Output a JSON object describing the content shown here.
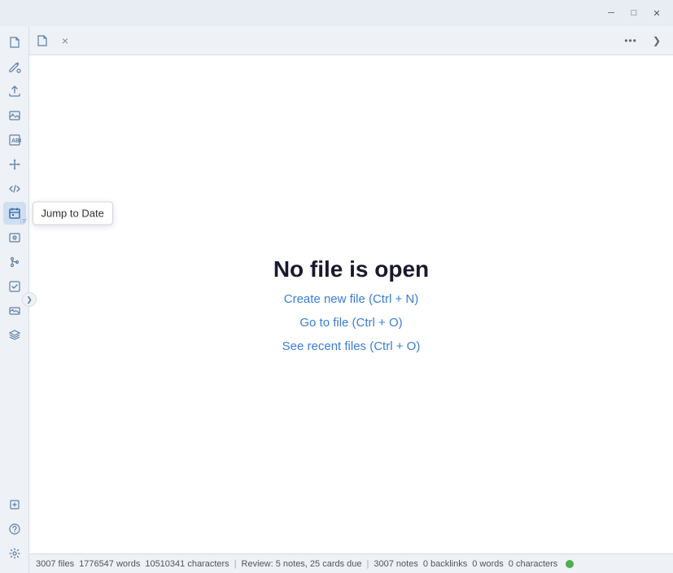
{
  "titlebar": {
    "minimize_label": "─",
    "maximize_label": "□",
    "close_label": "✕"
  },
  "sidebar": {
    "icons": [
      {
        "name": "file-icon",
        "symbol": "📄",
        "tooltip": null,
        "active": false
      },
      {
        "name": "paint-icon",
        "symbol": "🖌",
        "tooltip": null,
        "active": false
      },
      {
        "name": "upload-icon",
        "symbol": "⬆",
        "tooltip": null,
        "active": false
      },
      {
        "name": "image-icon",
        "symbol": "🖼",
        "tooltip": null,
        "active": false
      },
      {
        "name": "text-icon",
        "symbol": "Aa",
        "tooltip": null,
        "active": false
      },
      {
        "name": "move-icon",
        "symbol": "✛",
        "tooltip": null,
        "active": false
      },
      {
        "name": "code-icon",
        "symbol": "<>",
        "tooltip": null,
        "active": false
      },
      {
        "name": "calendar-icon",
        "symbol": "📅",
        "tooltip": "Jump to Date",
        "active": true
      },
      {
        "name": "preview-icon",
        "symbol": "👁",
        "tooltip": null,
        "active": false
      },
      {
        "name": "branch-icon",
        "symbol": "⑂",
        "tooltip": null,
        "active": false
      },
      {
        "name": "check-icon",
        "symbol": "✓",
        "tooltip": null,
        "active": false
      },
      {
        "name": "photo-icon",
        "symbol": "🖼",
        "tooltip": null,
        "active": false
      },
      {
        "name": "layers-icon",
        "symbol": "≡",
        "tooltip": null,
        "active": false
      }
    ],
    "bottom_icons": [
      {
        "name": "import-icon",
        "symbol": "⊕",
        "tooltip": null
      },
      {
        "name": "help-icon",
        "symbol": "?",
        "tooltip": null
      },
      {
        "name": "settings-icon",
        "symbol": "⚙",
        "tooltip": null
      }
    ]
  },
  "tabbar": {
    "file_icon": "📄",
    "close_label": "×",
    "more_label": "•••",
    "collapse_label": "❯"
  },
  "content": {
    "no_file_title": "No file is open",
    "links": [
      {
        "name": "create-new-file-link",
        "label": "Create new file (Ctrl + N)"
      },
      {
        "name": "go-to-file-link",
        "label": "Go to file (Ctrl + O)"
      },
      {
        "name": "see-recent-files-link",
        "label": "See recent files (Ctrl + O)"
      }
    ]
  },
  "statusbar": {
    "files": "3007 files",
    "words": "1776547 words",
    "characters": "10510341 characters",
    "review": "Review: 5 notes, 25 cards due",
    "notes": "3007 notes",
    "backlinks": "0 backlinks",
    "words2": "0 words",
    "characters2": "0 characters"
  }
}
